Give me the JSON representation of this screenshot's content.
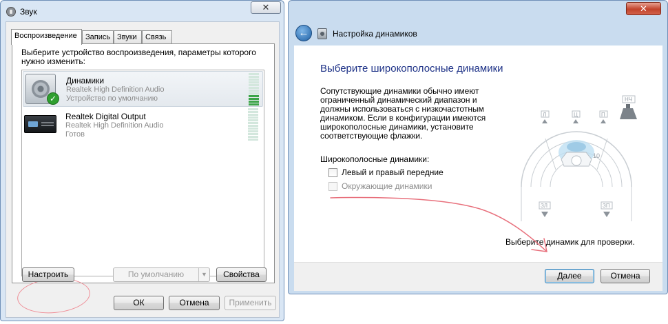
{
  "sound_window": {
    "title": "Звук",
    "close_glyph": "✕",
    "tabs": [
      "Воспроизведение",
      "Запись",
      "Звуки",
      "Связь"
    ],
    "description": "Выберите устройство воспроизведения, параметры которого нужно изменить:",
    "devices": [
      {
        "name": "Динамики",
        "driver": "Realtek High Definition Audio",
        "status": "Устройство по умолчанию",
        "icon": "speaker-icon",
        "default": true,
        "level_bars_lit": 4,
        "level_bars_total": 12
      },
      {
        "name": "Realtek Digital Output",
        "driver": "Realtek High Definition Audio",
        "status": "Готов",
        "icon": "digital-output-icon",
        "default": false,
        "level_bars_lit": 0,
        "level_bars_total": 12
      }
    ],
    "buttons": {
      "configure": "Настроить",
      "set_default": "По умолчанию",
      "properties": "Свойства",
      "ok": "ОК",
      "cancel": "Отмена",
      "apply": "Применить"
    }
  },
  "setup_window": {
    "title": "Настройка динамиков",
    "close_glyph": "✕",
    "back_glyph": "←",
    "heading": "Выберите широкополосные динамики",
    "description": "Сопутствующие динамики обычно имеют ограниченный динамический диапазон и должны использоваться с низкочастотным динамиком. Если в конфигурации имеются широкополосные динамики, установите соответствующие флажки.",
    "group_label": "Широкополосные динамики:",
    "checkboxes": [
      {
        "label": "Левый и правый передние",
        "checked": false,
        "enabled": true
      },
      {
        "label": "Окружающие динамики",
        "checked": false,
        "enabled": false
      }
    ],
    "diagram_labels": {
      "front_left": "Л",
      "center": "Ц",
      "front_right": "П",
      "subwoofer": "НЧ",
      "rear_left": "ЗЛ",
      "rear_right": "ЗП"
    },
    "test_hint": "Выберите динамик для проверки.",
    "buttons": {
      "next": "Далее",
      "cancel": "Отмена"
    }
  },
  "colors": {
    "heading_blue": "#1e3287",
    "annotation_red": "#e8707c",
    "level_green": "#3ca549"
  }
}
